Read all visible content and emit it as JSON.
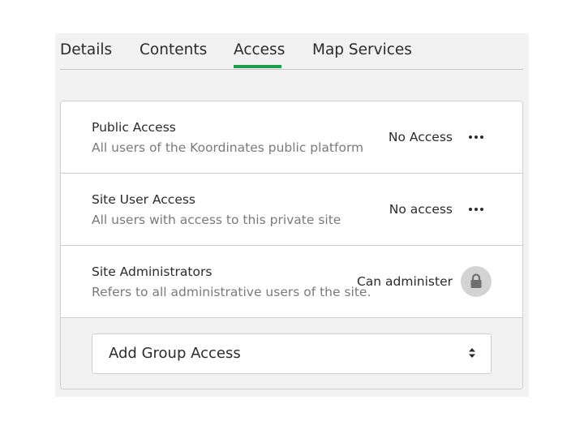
{
  "tabs": [
    {
      "label": "Details"
    },
    {
      "label": "Contents"
    },
    {
      "label": "Access",
      "active": true
    },
    {
      "label": "Map Services"
    }
  ],
  "access_rows": [
    {
      "title": "Public Access",
      "description": "All users of the Koordinates public platform",
      "level": "No Access",
      "action_icon": "ellipsis-icon"
    },
    {
      "title": "Site User Access",
      "description": "All users with access to this private site",
      "level": "No access",
      "action_icon": "ellipsis-icon"
    },
    {
      "title": "Site Administrators",
      "description": "Refers to all administrative users of the site.",
      "level": "Can administer",
      "action_icon": "lock-icon"
    }
  ],
  "add_group": {
    "label": "Add Group Access",
    "icon": "select-caret-icon"
  },
  "colors": {
    "active_tab_underline": "#1f9e4b",
    "panel_bg": "#f2f2f2",
    "lock_bg": "#d3d3d3"
  }
}
